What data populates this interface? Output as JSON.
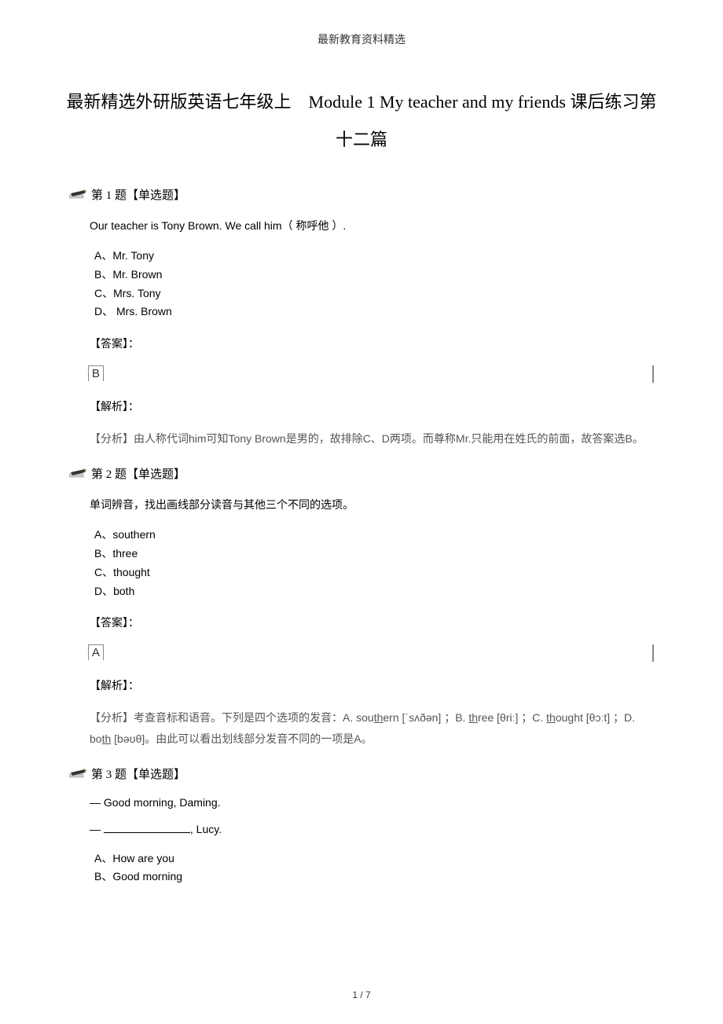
{
  "header": "最新教育资料精选",
  "title_line1": "最新精选外研版英语七年级上　Module 1 My teacher and my friends 课后练习第",
  "title_line2": "十二篇",
  "questions": [
    {
      "label": "第 1 题【单选题】",
      "text": "Our teacher is Tony Brown. We call him（ 称呼他 ）.",
      "options": [
        "A、Mr. Tony",
        "B、Mr. Brown",
        "C、Mrs. Tony",
        "D、 Mrs. Brown"
      ],
      "answer_label": "【答案】：",
      "answer": "B",
      "analysis_label": "【解析】：",
      "analysis": "【分析】由人称代词him可知Tony Brown是男的，故排除C、D两项。而尊称Mr.只能用在姓氏的前面，故答案选B。"
    },
    {
      "label": "第 2 题【单选题】",
      "text": "单词辨音，找出画线部分读音与其他三个不同的选项。",
      "options": [
        "A、southern",
        "B、three",
        "C、thought",
        "D、both"
      ],
      "answer_label": "【答案】：",
      "answer": "A",
      "analysis_label": "【解析】：",
      "analysis_parts": {
        "prefix": "【分析】考查音标和语音。下列是四个选项的发音：A. sou",
        "th1": "th",
        "mid1": "ern [ˈsʌðən] ；B. ",
        "th2": "th",
        "mid2": "ree [θriː] ；C. ",
        "th3": "th",
        "mid3": "ought [θɔːt] ；D. bo",
        "th4": "th",
        "suffix": " [bəʊθ]。由此可以看出划线部分发音不同的一项是A。"
      }
    },
    {
      "label": "第 3 题【单选题】",
      "line1": "— Good morning, Daming.",
      "line2_prefix": "— ",
      "line2_suffix": ", Lucy.",
      "options": [
        "A、How are you",
        "B、Good morning"
      ]
    }
  ],
  "footer": "1 / 7"
}
